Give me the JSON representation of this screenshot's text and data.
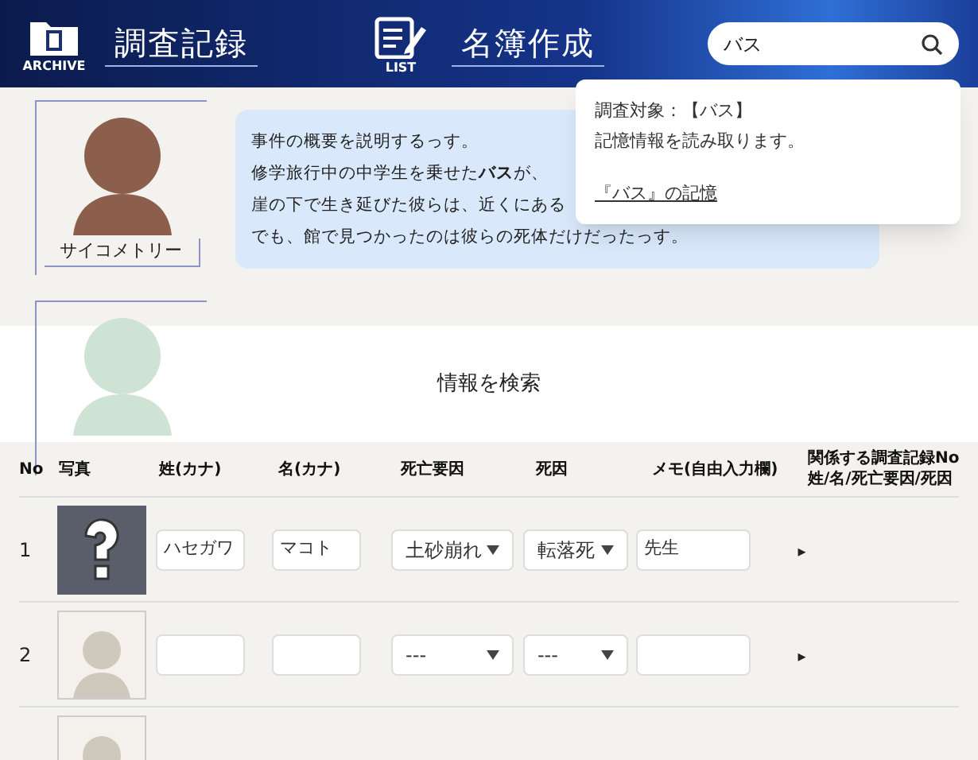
{
  "header": {
    "nav": [
      {
        "kind": "archive",
        "icon_label": "ARCHIVE",
        "label": "調査記録"
      },
      {
        "kind": "list",
        "icon_label": "LIST",
        "label": "名簿作成"
      }
    ],
    "search": {
      "value": "バス"
    }
  },
  "popup": {
    "lines": [
      "調査対象：【バス】",
      "記憶情報を読み取ります。"
    ],
    "link": "『バス』の記憶"
  },
  "characters": [
    {
      "kind": "girl",
      "label": "サイコメトリー",
      "message": [
        "事件の概要を説明するっす。",
        "修学旅行中の中学生を乗せた**バス**が、",
        "崖の下で生き延びた彼らは、近くにある",
        "でも、館で見つかったのは彼らの死体だけだったっす。"
      ]
    },
    {
      "kind": "mascot"
    }
  ],
  "search_button": "情報を検索",
  "table": {
    "columns": [
      "No",
      "写真",
      "姓(カナ)",
      "名(カナ)",
      "死亡要因",
      "死因",
      "メモ(自由入力欄)",
      "関係する調査記録No\n姓/名/死亡要因/死因"
    ],
    "rows": [
      {
        "kind": "unknown",
        "no": "1",
        "last": "ハセガワ",
        "first": "マコト",
        "cause": "土砂崩れ",
        "death": "転落死",
        "memo": "先生",
        "expand": "▸"
      },
      {
        "kind": "portrait",
        "no": "2",
        "last": "",
        "first": "",
        "cause": "---",
        "death": "---",
        "memo": "",
        "expand": "▸"
      },
      {
        "kind": "portrait"
      }
    ]
  }
}
